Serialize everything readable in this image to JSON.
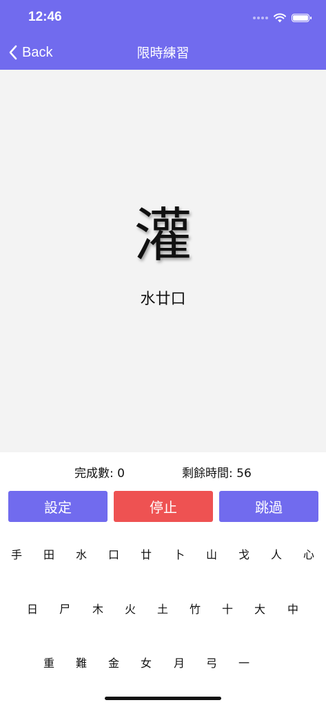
{
  "status_bar": {
    "time": "12:46"
  },
  "nav": {
    "back_label": "Back",
    "title": "限時練習"
  },
  "practice": {
    "character": "灌",
    "code": "水廿口"
  },
  "stats": {
    "done_label": "完成數:",
    "done_value": "0",
    "time_label": "剩餘時間:",
    "time_value": "56"
  },
  "buttons": {
    "settings": "設定",
    "stop": "停止",
    "skip": "跳過"
  },
  "keyboard": {
    "row1": [
      "手",
      "田",
      "水",
      "口",
      "廿",
      "卜",
      "山",
      "戈",
      "人",
      "心"
    ],
    "row2": [
      "日",
      "尸",
      "木",
      "火",
      "土",
      "竹",
      "十",
      "大",
      "中"
    ],
    "row3": [
      "重",
      "難",
      "金",
      "女",
      "月",
      "弓",
      "一"
    ]
  },
  "colors": {
    "accent": "#716bee",
    "stop": "#ee5252",
    "panel": "#f3f3f3"
  }
}
